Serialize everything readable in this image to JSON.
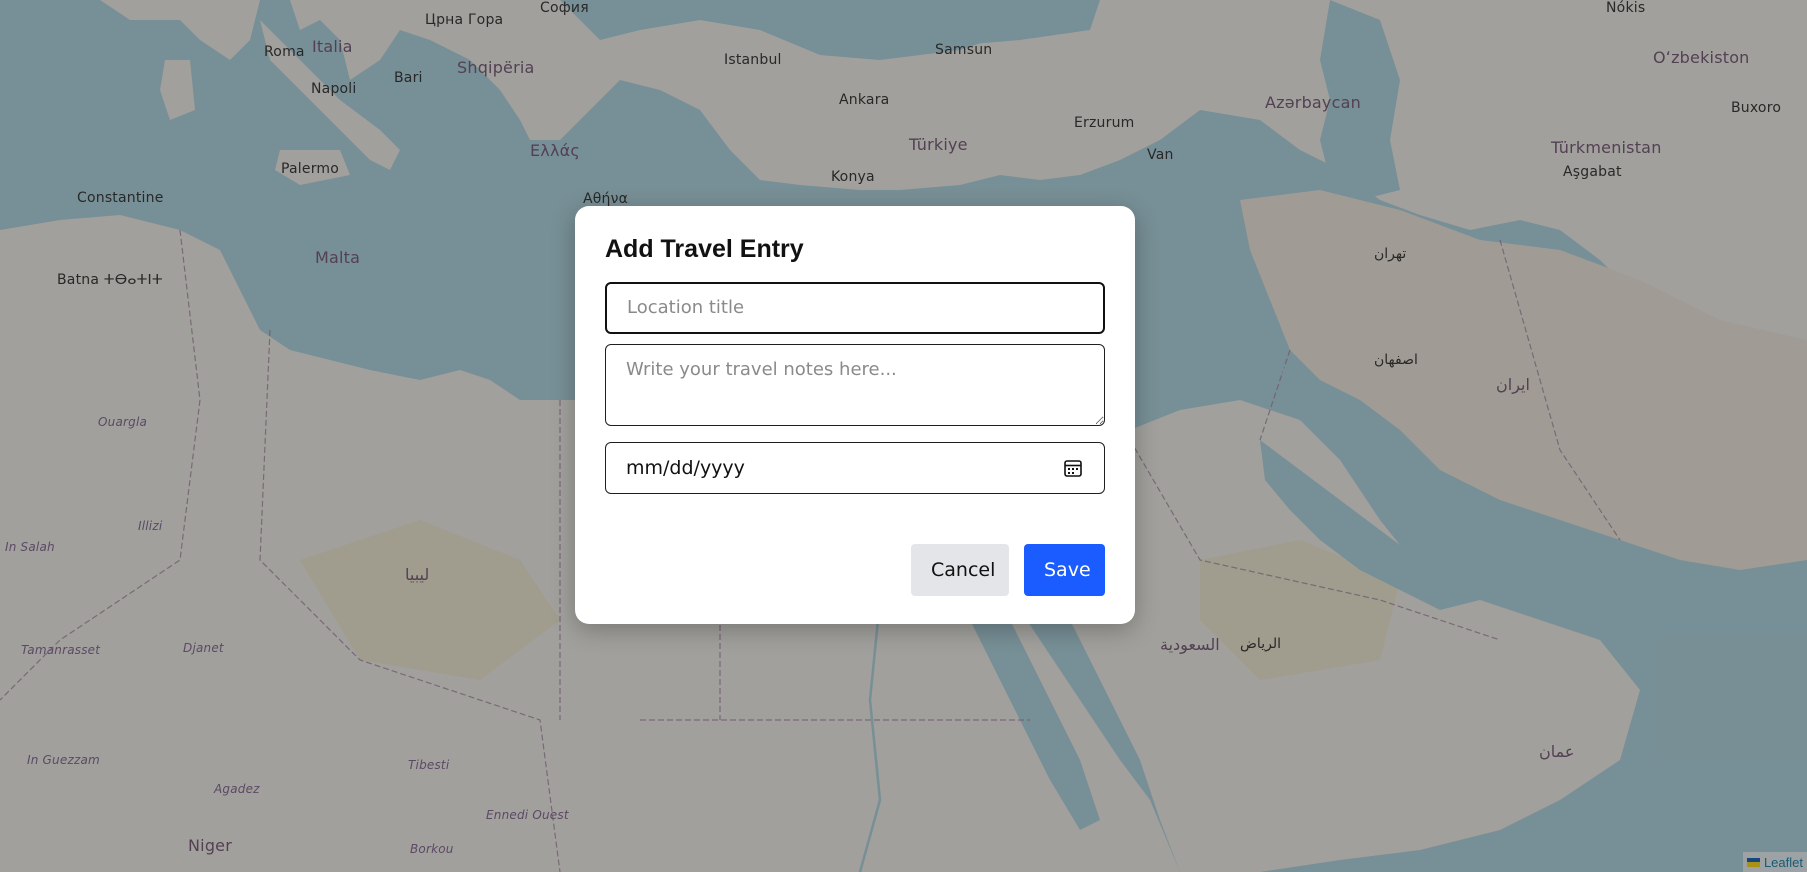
{
  "map": {
    "labels": {
      "italia": "Italia",
      "roma": "Roma",
      "napoli": "Napoli",
      "bari": "Bari",
      "palermo": "Palermo",
      "malta": "Malta",
      "constantine": "Constantine",
      "batna": "Batna ⵜⴱⴰⵜⵏⵜ",
      "shqiperia": "Shqipëria",
      "sofia": "София",
      "crna_gora": "Црна Гора",
      "istanbul": "Istanbul",
      "ankara": "Ankara",
      "turkiye": "Türkiye",
      "samsun": "Samsun",
      "ellas": "Ελλάς",
      "athina": "Αθήνα",
      "konya": "Konya",
      "erzurum": "Erzurum",
      "van": "Van",
      "azarbaycan": "Azərbaycan",
      "ozbekiston": "Oʻzbekiston",
      "turkmenistan": "Türkmenistan",
      "asgabat": "Aşgabat",
      "nokis": "Nókis",
      "buxoro": "Buxoro",
      "ouargla": "Ouargla",
      "illizi": "Illizi",
      "in_salah": "In Salah",
      "djanet": "Djanet",
      "tamanrasset": "Tamanrasset",
      "in_guezzam": "In Guezzam",
      "agadez": "Agadez",
      "niger": "Niger",
      "tibesti": "Tibesti",
      "ennedi": "Ennedi Ouest",
      "borkou": "Borkou",
      "libya": "ليبيا",
      "saudi": "السعودية",
      "riyadh": "الرياض",
      "iran": "ایران",
      "oman": "عمان",
      "tehran": "تهران",
      "isfahan": "اصفهان"
    },
    "attribution": "Leaflet"
  },
  "modal": {
    "title": "Add Travel Entry",
    "location_placeholder": "Location title",
    "notes_placeholder": "Write your travel notes here...",
    "date_placeholder": "mm/dd/yyyy",
    "cancel_label": "Cancel",
    "save_label": "Save"
  },
  "colors": {
    "save_button": "#1a5cff",
    "cancel_button": "#e3e5e8",
    "sea": "#aad3df",
    "land": "#f2efe9"
  }
}
